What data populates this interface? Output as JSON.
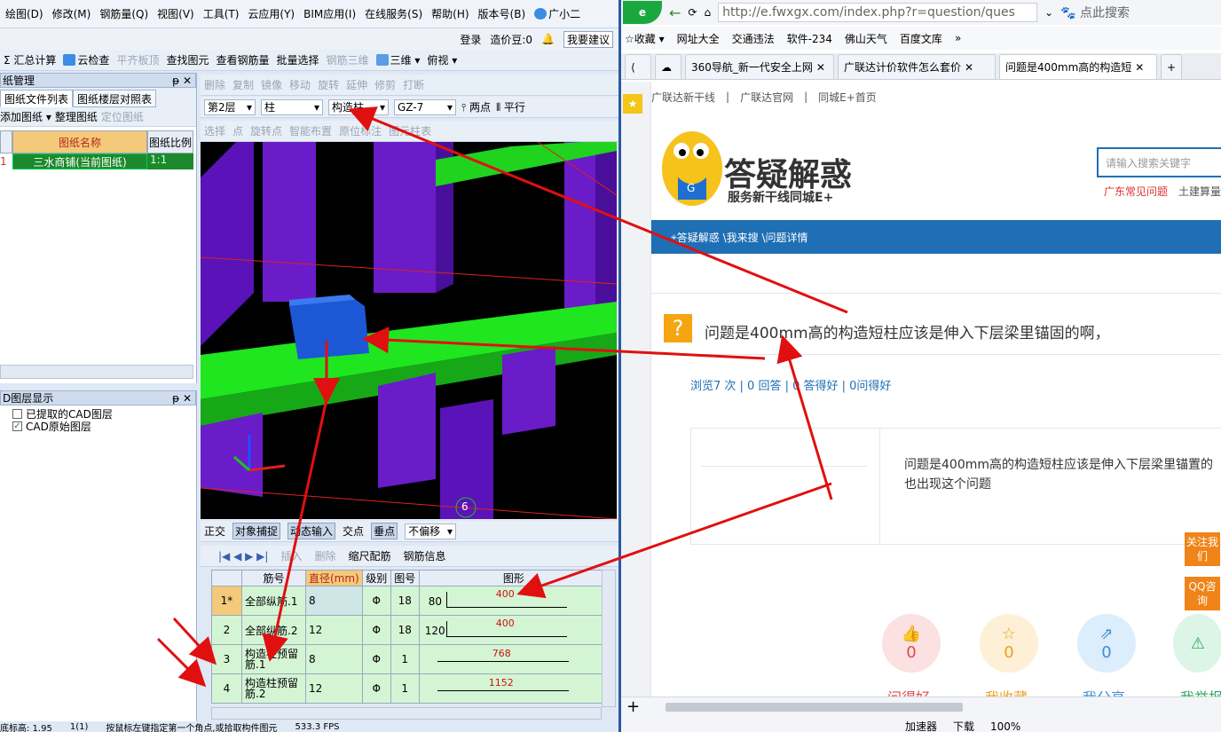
{
  "app": {
    "menu": [
      "绘图(D)",
      "修改(M)",
      "钢筋量(Q)",
      "视图(V)",
      "工具(T)",
      "云应用(Y)",
      "BIM应用(I)",
      "在线服务(S)",
      "帮助(H)",
      "版本号(B)",
      "广小二"
    ],
    "login": "登录",
    "price_beans": "造价豆:0",
    "suggest": "我要建议",
    "toolbar1": [
      "汇总计算",
      "云检查",
      "平齐板顶",
      "查找图元",
      "查看钢筋量",
      "批量选择",
      "钢筋三维",
      "三维",
      "俯视"
    ],
    "toolbar2": [
      "删除",
      "复制",
      "镜像",
      "移动",
      "旋转",
      "延伸",
      "修剪",
      "打断"
    ],
    "selectors": {
      "floor": "第2层",
      "type": "柱",
      "sub": "构造柱",
      "name": "GZ-7",
      "two_point": "两点",
      "parallel": "平行"
    },
    "toolbar3": [
      "选择",
      "点",
      "旋转点",
      "智能布置",
      "原位标注",
      "图元柱表"
    ],
    "drawing_panel": {
      "title": "纸管理",
      "tabs": [
        "图纸文件列表",
        "图纸楼层对照表"
      ],
      "buttons": [
        "添加图纸",
        "整理图纸",
        "定位图纸"
      ],
      "col_name": "图纸名称",
      "col_scale": "图纸比例",
      "row": {
        "idx": "1",
        "name": "三水商铺(当前图纸)",
        "scale": "1:1"
      }
    },
    "layer_panel": {
      "title": "D图层显示",
      "items": [
        "已提取的CAD图层",
        "CAD原始图层"
      ]
    },
    "snap_bar": [
      "正交",
      "对象捕捉",
      "动态输入",
      "交点",
      "垂点",
      "不偏移"
    ],
    "rebar_bar": [
      "插入",
      "删除",
      "缩尺配筋",
      "钢筋信息"
    ],
    "axis_label": "6",
    "rebar_headers": [
      "筋号",
      "直径(mm)",
      "级别",
      "图号",
      "图形"
    ],
    "rebar_rows": [
      {
        "idx": "1*",
        "name": "全部纵筋.1",
        "dia": "8",
        "grade": "Φ",
        "fig": "18",
        "left": "80",
        "len": "400"
      },
      {
        "idx": "2",
        "name": "全部纵筋.2",
        "dia": "12",
        "grade": "Φ",
        "fig": "18",
        "left": "120",
        "len": "400"
      },
      {
        "idx": "3",
        "name": "构造柱预留筋.1",
        "dia": "8",
        "grade": "Φ",
        "fig": "1",
        "left": "",
        "len": "768"
      },
      {
        "idx": "4",
        "name": "构造柱预留筋.2",
        "dia": "12",
        "grade": "Φ",
        "fig": "1",
        "left": "",
        "len": "1152"
      }
    ],
    "status": [
      "底标高: 1.95",
      "1(1)",
      "按鼠标左键指定第一个角点,或拾取构件图元",
      "533.3 FPS"
    ]
  },
  "browser": {
    "url": "http://e.fwxgx.com/index.php?r=question/ques",
    "search_hint": "点此搜索",
    "bookmarks": [
      "收藏",
      "网址大全",
      "交通违法",
      "软件-234",
      "佛山天气",
      "百度文库"
    ],
    "tabs": [
      "360导航_新一代安全上网",
      "广联达计价软件怎么套价",
      "问题是400mm高的构造短"
    ],
    "top_links": [
      "广联达新干线",
      "广联达官网",
      "同城E+首页"
    ],
    "logo_title": "答疑解惑",
    "logo_sub": "服务新干线同城E+",
    "search_placeholder": "请输入搜索关键字",
    "sub_links": [
      "广东常见问题",
      "土建算量"
    ],
    "breadcrumb": "答疑解惑 \\我来搜 \\问题详情",
    "question_title": "问题是400mm高的构造短柱应该是伸入下层梁里锚固的啊，",
    "stats": "浏览7 次 | 0 回答 | 0 答得好 | 0问得好",
    "body_text": "问题是400mm高的构造短柱应该是伸入下层梁里锚置的也出现这个问题",
    "side_follow": "关注我们",
    "side_qq": "QQ咨询",
    "actions": [
      {
        "label": "问得好",
        "count": "0"
      },
      {
        "label": "我收藏",
        "count": "0"
      },
      {
        "label": "我分享",
        "count": "0"
      },
      {
        "label": "我举报",
        "count": ""
      }
    ],
    "statusbar": [
      "加速器",
      "下载",
      "100%"
    ]
  }
}
